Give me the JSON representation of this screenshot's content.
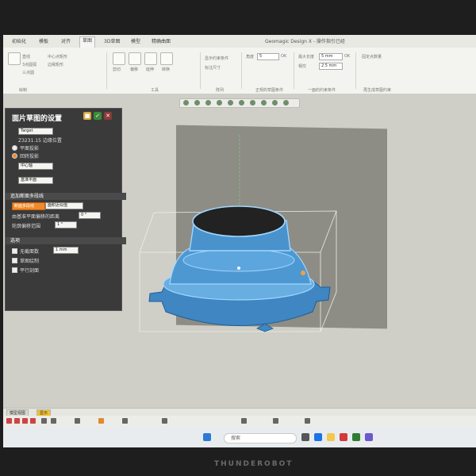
{
  "app": {
    "title": "Geomagic Design X - 操作指引已经"
  },
  "tabs": [
    {
      "label": "初始化"
    },
    {
      "label": "模板"
    },
    {
      "label": "对齐"
    },
    {
      "label": "草图"
    },
    {
      "label": "3D草图"
    },
    {
      "label": "模型"
    },
    {
      "label": "精确曲面"
    }
  ],
  "ribbon": {
    "groups": [
      {
        "label": "绘制"
      },
      {
        "label": "工具"
      },
      {
        "label": "阵列"
      },
      {
        "label": "正规的草图条件"
      },
      {
        "label": "一面的约束条件"
      },
      {
        "label": "再生成草图约束"
      }
    ],
    "items": [
      {
        "label": "直线"
      },
      {
        "label": "3点圆弧"
      },
      {
        "label": "三点圆"
      },
      {
        "label": "中心点矩形"
      },
      {
        "label": "边缘矩形"
      },
      {
        "label": "剪切"
      },
      {
        "label": "偏移"
      },
      {
        "label": "延伸"
      },
      {
        "label": "转换"
      },
      {
        "label": "显示约束条件"
      },
      {
        "label": "标注尺寸"
      }
    ],
    "angle_label": "角度",
    "angle_value": "5",
    "max_len_label": "最大长度",
    "max_len_value": "5 mm",
    "tol_label": "相交",
    "tol_value": "2.5 mm",
    "ok_label": "OK",
    "fix_label": "固定点数量"
  },
  "panel": {
    "title": "面片草图的设置",
    "target_label": "Target",
    "target_sub": "Z3231.15 边缘位置",
    "opt_plane": "平面投影",
    "opt_rotate": "回转投影",
    "base_plane_label": "基准平面",
    "angle_label": "中心轴",
    "section_label": "追加断面多段线",
    "sel_label": "断面多段线",
    "sel_value": "面积近似值",
    "offset_label": "由基准平面偏移的距离",
    "offset_value": "0 °",
    "count_label": "轮廓偏移范围",
    "count_value": "1 °",
    "options_header": "选项",
    "opt1": "无截面数",
    "opt1_value": "1 mm",
    "opt2": "草图绘制",
    "opt3": "平行剖面"
  },
  "bottom": {
    "tabs": [
      {
        "label": "模型视图"
      },
      {
        "label": "显示"
      }
    ]
  },
  "taskbar": {
    "search_placeholder": "搜索"
  },
  "hardware": {
    "brand": "THUNDEROBOT"
  },
  "colors": {
    "accent": "#f08a2a",
    "model": "#5aa3d6",
    "selection": "#9fd6ff"
  }
}
